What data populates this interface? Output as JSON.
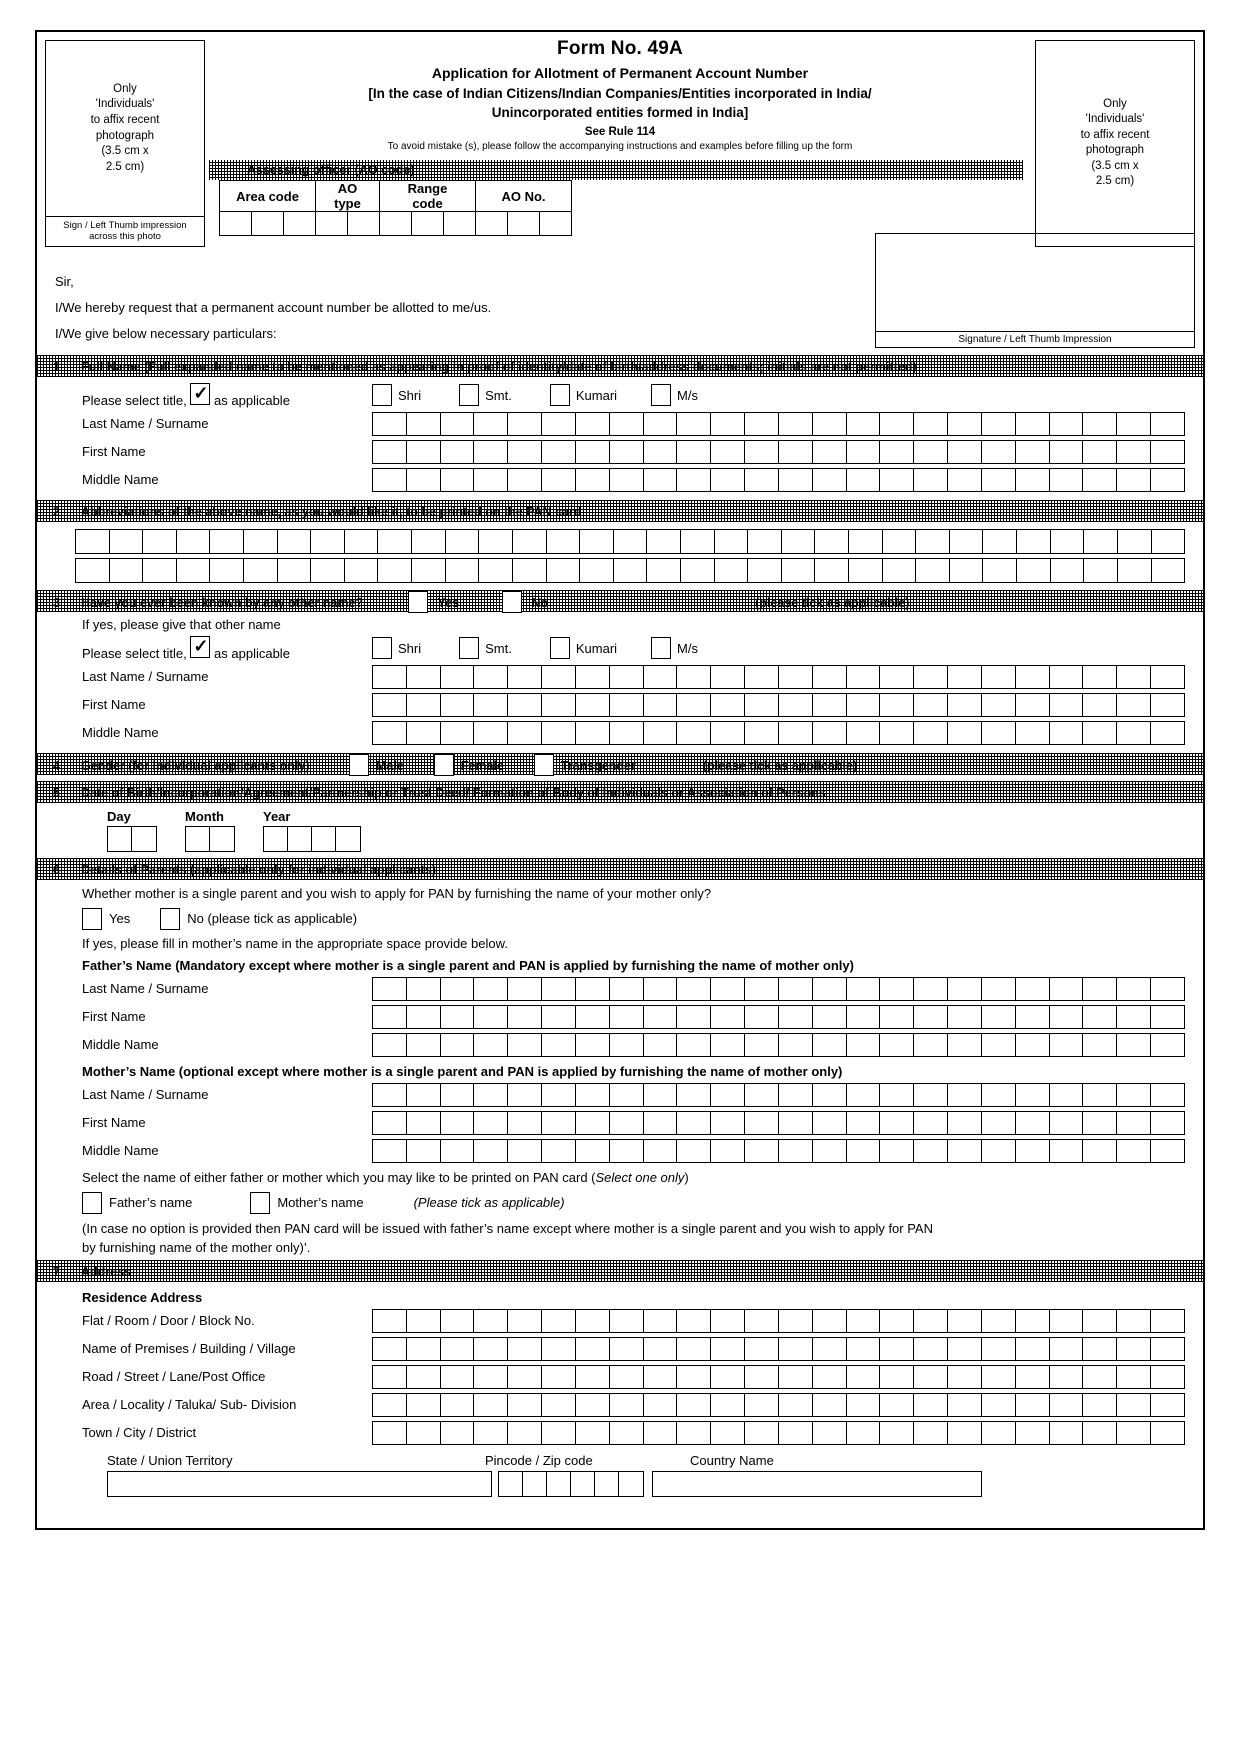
{
  "header": {
    "photo_left": "Only\n'Individuals'\nto affix recent\nphotograph\n(3.5 cm x\n2.5 cm)",
    "photo_left_caption": "Sign / Left Thumb impression\nacross this photo",
    "photo_right": "Only\n'Individuals'\nto affix recent\nphotograph\n(3.5 cm x\n2.5 cm)",
    "title": "Form No. 49A",
    "subtitle": "Application for Allotment of Permanent Account Number",
    "scope_line1": "[In the case of Indian Citizens/Indian Companies/Entities incorporated in India/",
    "scope_line2": "Unincorporated entities formed in India]",
    "rule": "See Rule 114",
    "instruction": "To avoid mistake (s), please follow the accompanying instructions and examples before filling up the form"
  },
  "ao": {
    "bar_label": "Assessing officer (AO code)",
    "columns": [
      {
        "label": "Area code",
        "cells": 3
      },
      {
        "label": "AO type",
        "cells": 2
      },
      {
        "label": "Range code",
        "cells": 3
      },
      {
        "label": "AO No.",
        "cells": 3
      }
    ]
  },
  "letter": {
    "salutation": "Sir,",
    "line1": "I/We hereby request that a permanent account number be allotted to me/us.",
    "line2": "I/We give below necessary particulars:",
    "signature_caption": "Signature / Left Thumb Impression"
  },
  "titles": [
    "Shri",
    "Smt.",
    "Kumari",
    "M/s"
  ],
  "title_prompt_pre": "Please select title,",
  "title_prompt_post": "as applicable",
  "name_labels": [
    "Last Name / Surname",
    "First Name",
    "Middle Name"
  ],
  "sections": {
    "s1": {
      "num": "1",
      "label": "Full Name (Full expanded name to be mentioned as appearing in proof of identity/date of birth/address documents; initials are not permitted)"
    },
    "s2": {
      "num": "2",
      "label": "Abbreviations of the above name, as you would like it, to be printed on the PAN card"
    },
    "s3": {
      "num": "3",
      "label": "Have you ever been known by any other name?",
      "yes": "Yes",
      "no": "No",
      "tick_hint": "(please tick as applicable)",
      "if_yes": "If yes, please give that other name"
    },
    "s4": {
      "num": "4",
      "label": "Gender (for individual applicants only)",
      "options": [
        "Male",
        "Female",
        "Transgender"
      ],
      "tick_hint": "(please tick as applicable)"
    },
    "s5": {
      "num": "5",
      "label": "Date of Birth/Incorporation/Agreement/Partnership or Trust Deed/ Formation of Body of Individuals or Association of Persons",
      "day": "Day",
      "month": "Month",
      "year": "Year"
    },
    "s6": {
      "num": "6",
      "label": "Details of Parents (applicable only for individual applicants)",
      "q_single_parent": "Whether mother is a single parent and you wish to apply for PAN by furnishing the name of your mother only?",
      "yes": "Yes",
      "no": "No (please tick as applicable)",
      "hint_fill": "If yes, please fill in mother’s name in the appropriate space provide below.",
      "father_heading": "Father’s Name (Mandatory except where mother is a single parent and PAN is applied by furnishing the name of mother only)",
      "mother_heading": "Mother’s Name (optional except where mother is a single parent and PAN is applied by furnishing the name of mother only)",
      "select_print": "Select the name of either father or mother which you may like to be printed on PAN card (",
      "select_print_ital": "Select one only",
      "select_print_end": ")",
      "father_name_opt": "Father’s name",
      "mother_name_opt": "Mother’s name",
      "tick_hint_ital": "(Please tick as applicable)",
      "footnote_l1": "(In case no option is provided then PAN card will be issued with father’s name except where mother is a single parent and you wish to apply for PAN",
      "footnote_l2": "by furnishing name of the mother only)’."
    },
    "s7": {
      "num": "7",
      "label": "Address",
      "residence_heading": "Residence Address",
      "fields": [
        "Flat / Room / Door / Block No.",
        "Name of Premises / Building / Village",
        "Road / Street / Lane/Post Office",
        "Area / Locality / Taluka/ Sub- Division",
        "Town / City / District"
      ],
      "state_label": "State / Union Territory",
      "pincode_label": "Pincode / Zip code",
      "country_label": "Country Name"
    }
  },
  "grid_counts": {
    "name_cells": 24,
    "abbrev_cells": 33,
    "day_cells": 2,
    "month_cells": 2,
    "year_cells": 4,
    "pincode_cells": 6
  }
}
